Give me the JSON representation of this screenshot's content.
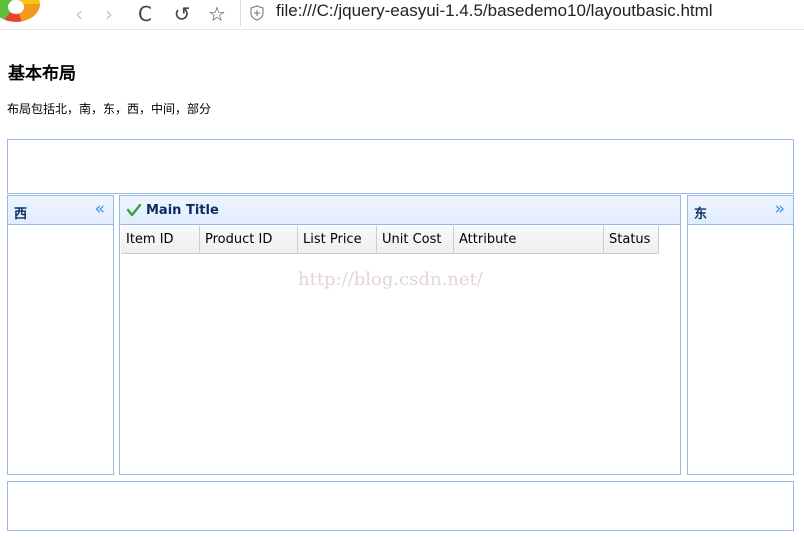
{
  "browser": {
    "back_icon": "‹",
    "forward_icon": "›",
    "reload_icon": "C",
    "undo_icon": "↺",
    "star_icon": "☆",
    "url": "file:///C:/jquery-easyui-1.4.5/basedemo10/layoutbasic.html"
  },
  "page": {
    "title": "基本布局",
    "description": "布局包括北，南，东，西，中间，部分"
  },
  "layout": {
    "west": {
      "title": "西",
      "tool": "«"
    },
    "east": {
      "title": "东",
      "tool": "»"
    },
    "center": {
      "title": "Main Title",
      "columns": [
        "Item ID",
        "Product ID",
        "List Price",
        "Unit Cost",
        "Attribute",
        "Status"
      ],
      "watermark": "http://blog.csdn.net/"
    }
  },
  "colors": {
    "border": "#95b8e7",
    "header_title": "#0e2d5f",
    "tool": "#3c8fd8",
    "check": "#3aa33a"
  }
}
